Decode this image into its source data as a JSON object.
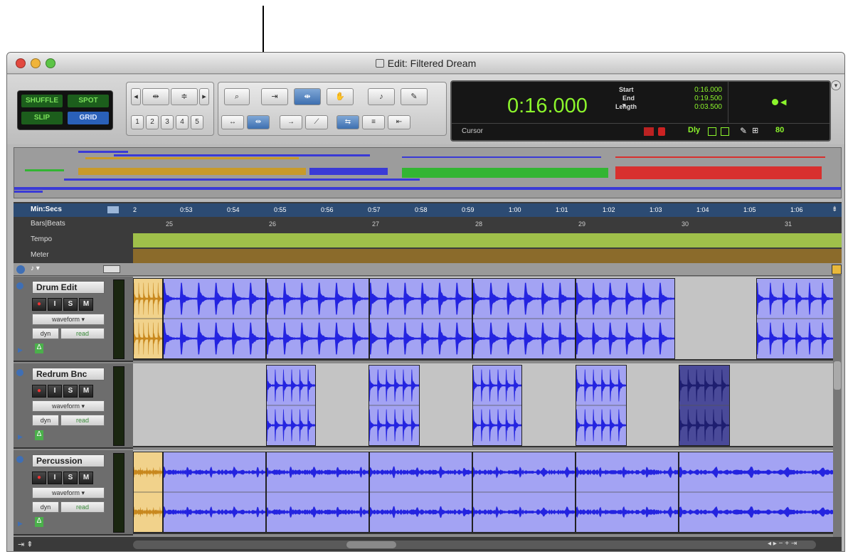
{
  "window": {
    "title": "Edit: Filtered Dream"
  },
  "edit_modes": {
    "shuffle": "SHUFFLE",
    "spot": "SPOT",
    "slip": "SLIP",
    "grid": "GRID"
  },
  "zoom_presets": [
    "1",
    "2",
    "3",
    "4",
    "5"
  ],
  "counter": {
    "main": "0:16.000",
    "start_label": "Start",
    "start_value": "0:16.000",
    "end_label": "End",
    "end_value": "0:19.500",
    "length_label": "Length",
    "length_value": "0:03.500",
    "cursor_label": "Cursor",
    "dly": "Dly",
    "nudge": "80"
  },
  "rulers": {
    "minsecs": "Min:Secs",
    "barsbeats": "Bars|Beats",
    "tempo": "Tempo",
    "meter": "Meter",
    "ticks": [
      "2",
      "0:53",
      "0:54",
      "0:55",
      "0:56",
      "0:57",
      "0:58",
      "0:59",
      "1:00",
      "1:01",
      "1:02",
      "1:03",
      "1:04",
      "1:05",
      "1:06"
    ],
    "bars": [
      "25",
      "26",
      "27",
      "28",
      "29",
      "30",
      "31"
    ]
  },
  "tracks": [
    {
      "name": "Drum Edit",
      "view": "waveform",
      "auto_a": "dyn",
      "auto_b": "read"
    },
    {
      "name": "Redrum Bnc",
      "view": "waveform",
      "auto_a": "dyn",
      "auto_b": "read"
    },
    {
      "name": "Percussion",
      "view": "waveform",
      "auto_a": "dyn",
      "auto_b": "read"
    }
  ],
  "track_buttons": {
    "rec": "●",
    "input": "I",
    "solo": "S",
    "mute": "M"
  },
  "colors": {
    "universe_orange": "#c89a2a",
    "universe_green": "#33b533",
    "universe_red": "#d8302e",
    "universe_blue": "#3a3ad6",
    "clip": "#a3a3f3",
    "waveform": "#2424e0"
  }
}
